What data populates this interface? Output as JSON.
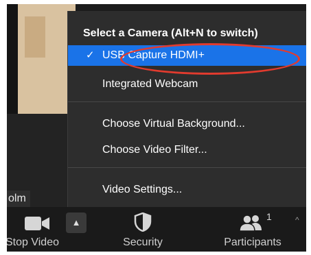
{
  "camera_menu": {
    "header": "Select a Camera (Alt+N to switch)",
    "items": [
      {
        "label": "USB Capture HDMI+",
        "selected": true
      },
      {
        "label": "Integrated Webcam",
        "selected": false
      }
    ],
    "options": [
      {
        "label": "Choose Virtual Background..."
      },
      {
        "label": "Choose Video Filter..."
      }
    ],
    "settings": {
      "label": "Video Settings..."
    },
    "check_glyph": "✓",
    "accent_color": "#1a73e8",
    "annotation_color": "#e23b2e"
  },
  "participant_name": "olm",
  "toolbar": {
    "stop_video": {
      "label": "Stop Video",
      "icon": "video-camera-icon"
    },
    "security": {
      "label": "Security",
      "icon": "shield-icon"
    },
    "participants": {
      "label": "Participants",
      "count": "1",
      "icon": "participants-icon"
    }
  }
}
